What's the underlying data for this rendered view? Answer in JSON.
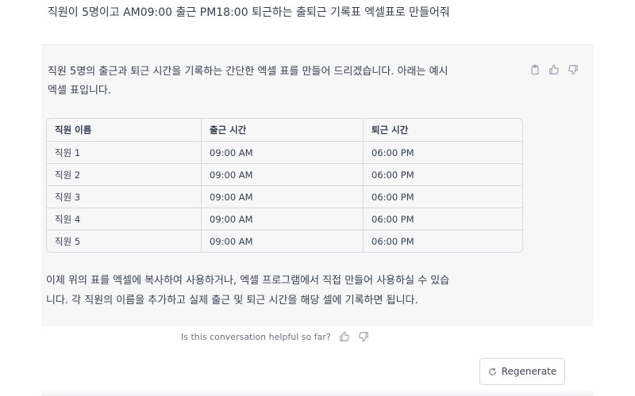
{
  "user_message": "직원이 5명이고 AM09:00 출근 PM18:00 퇴근하는 출퇴근 기록표 엑셀표로 만들어줘",
  "assistant": {
    "intro_line1": "직원 5명의 출근과 퇴근 시간을 기록하는 간단한 엑셀 표를 만들어 드리겠습니다. 아래는 예시",
    "intro_line2": "엑셀 표입니다.",
    "table": {
      "headers": [
        "직원 이름",
        "출근 시간",
        "퇴근 시간"
      ],
      "rows": [
        [
          "직원 1",
          "09:00 AM",
          "06:00 PM"
        ],
        [
          "직원 2",
          "09:00 AM",
          "06:00 PM"
        ],
        [
          "직원 3",
          "09:00 AM",
          "06:00 PM"
        ],
        [
          "직원 4",
          "09:00 AM",
          "06:00 PM"
        ],
        [
          "직원 5",
          "09:00 AM",
          "06:00 PM"
        ]
      ]
    },
    "outro_line1": "이제 위의 표를 엑셀에 복사하여 사용하거나, 엑셀 프로그램에서 직접 만들어 사용하실 수 있습",
    "outro_line2": "니다. 각 직원의 이름을 추가하고 실제 출근 및 퇴근 시간을 해당 셀에 기록하면 됩니다.",
    "actions": {
      "icons": [
        "clipboard-icon",
        "thumbs-up-icon",
        "thumbs-down-icon"
      ]
    }
  },
  "feedback": {
    "prompt": "Is this conversation helpful so far?"
  },
  "regenerate": {
    "label": "Regenerate",
    "icon": "refresh-icon"
  },
  "colors": {
    "assistant_bg": "#f7f7f8",
    "text": "#374151",
    "icon": "#9ca3af",
    "border": "#d9d9e3"
  }
}
